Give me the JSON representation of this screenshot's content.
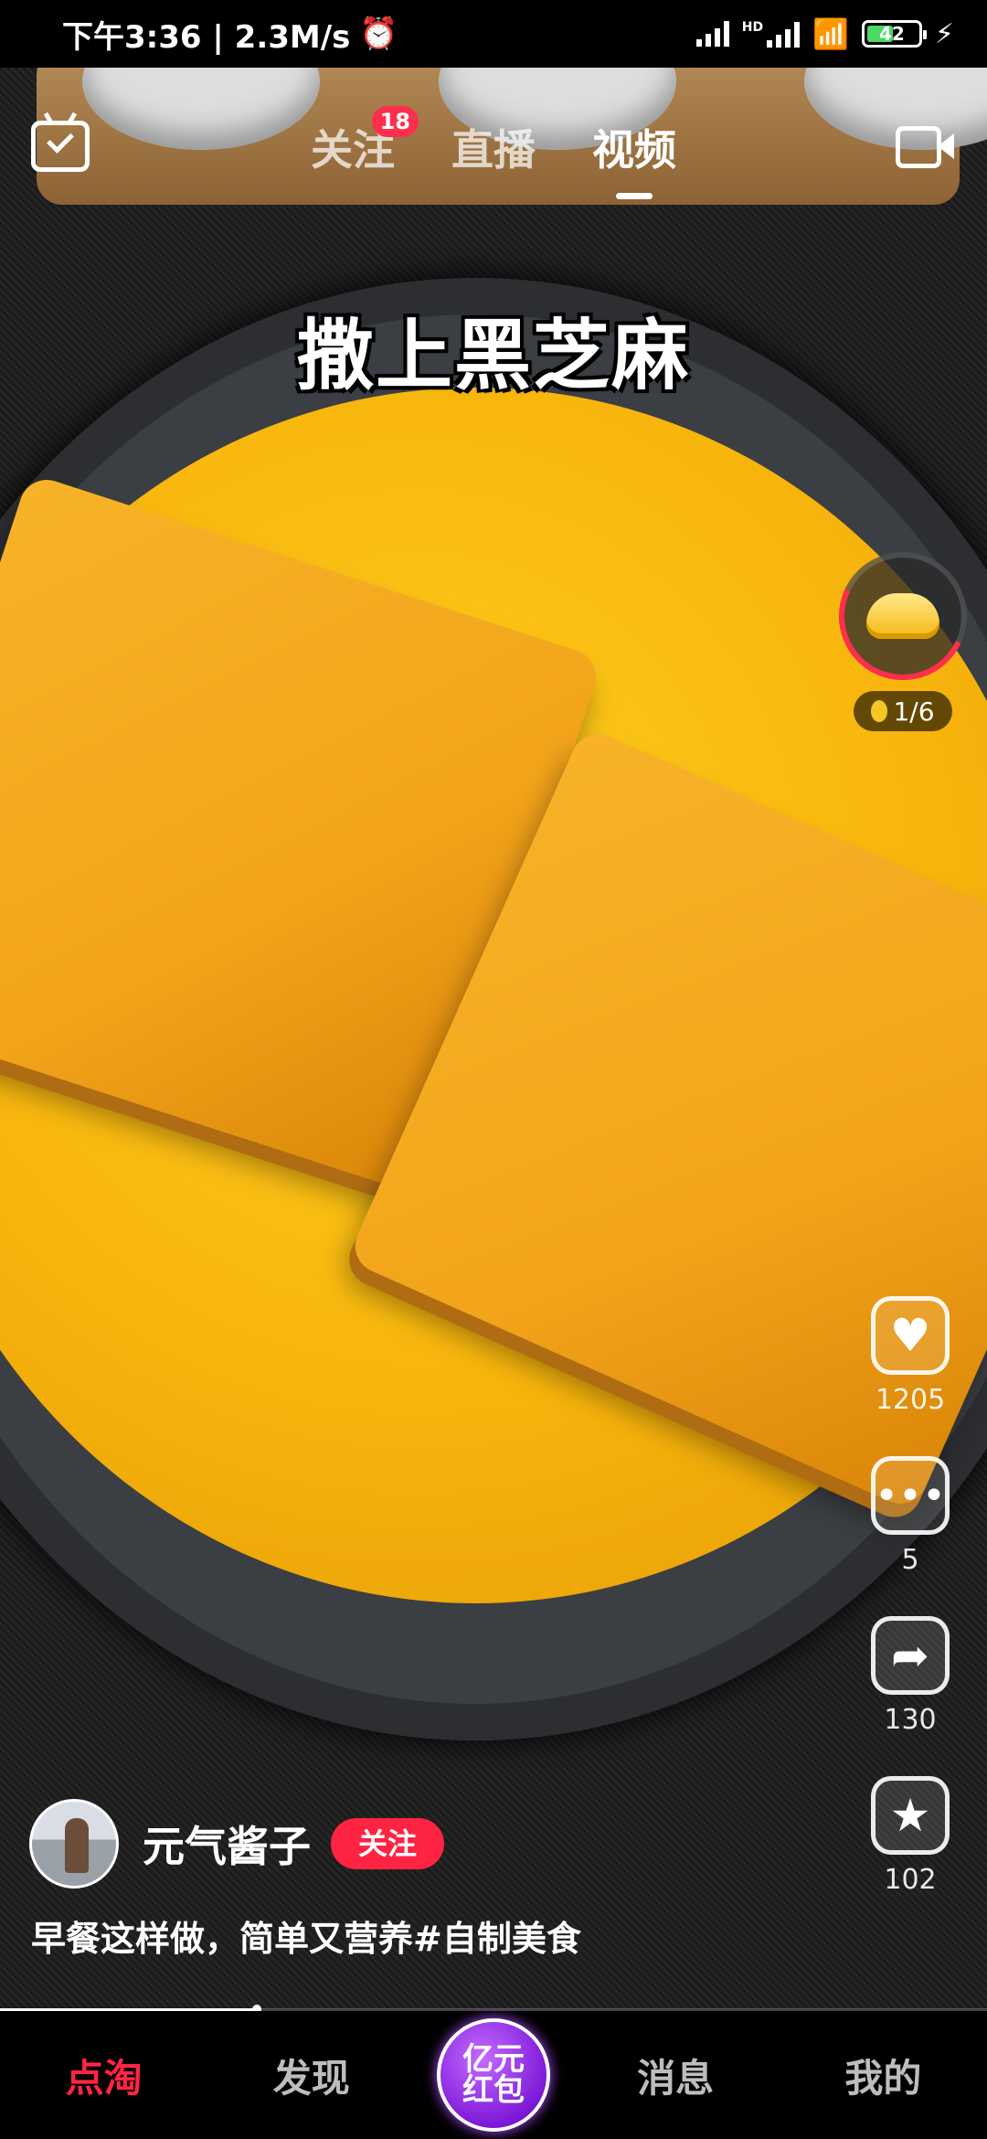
{
  "status_bar": {
    "time_speed": "下午3:36 | 2.3M/s",
    "network_label": "HD",
    "battery": "42"
  },
  "top_nav": {
    "tabs": [
      {
        "label": "关注",
        "badge": "18"
      },
      {
        "label": "直播"
      },
      {
        "label": "视频"
      }
    ],
    "active_tab": "视频"
  },
  "video": {
    "caption": "撒上黑芝麻",
    "progress": 0.26
  },
  "reward": {
    "count": "1/6"
  },
  "actions": {
    "likes": "1205",
    "comments": "5",
    "shares": "130",
    "favorites": "102"
  },
  "author": {
    "name": "元气酱子",
    "follow_label": "关注"
  },
  "description": "早餐这样做，简单又营养#自制美食",
  "bottom_nav": {
    "items": [
      "点淘",
      "发现",
      "亿元红包",
      "消息",
      "我的"
    ],
    "active": "点淘"
  },
  "colors": {
    "accent": "#ff2442",
    "reward_purple": "#7a16d6"
  }
}
